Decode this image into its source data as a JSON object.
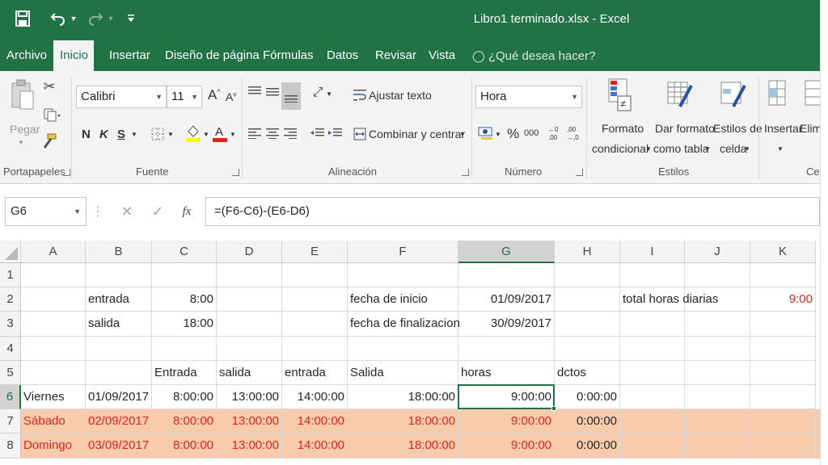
{
  "window": {
    "title": "Libro1 terminado.xlsx - Excel"
  },
  "quick_access": {
    "save_icon": "save-icon",
    "undo_icon": "undo-icon",
    "redo_icon": "redo-icon",
    "customize_icon": "customize-icon"
  },
  "tabs": [
    {
      "label": "Archivo"
    },
    {
      "label": "Inicio"
    },
    {
      "label": "Insertar"
    },
    {
      "label": "Diseño de página"
    },
    {
      "label": "Fórmulas"
    },
    {
      "label": "Datos"
    },
    {
      "label": "Revisar"
    },
    {
      "label": "Vista"
    }
  ],
  "tell_me": "¿Qué desea hacer?",
  "ribbon": {
    "clipboard": {
      "paste_label": "Pegar",
      "group": "Portapapeles"
    },
    "font": {
      "name": "Calibri",
      "size": "11",
      "bold": "N",
      "italic": "K",
      "underline": "S",
      "group": "Fuente"
    },
    "alignment": {
      "wrap": "Ajustar texto",
      "merge": "Combinar y centrar",
      "group": "Alineación"
    },
    "number": {
      "format": "Hora",
      "percent": "%",
      "thousands": "000",
      "group": "Número"
    },
    "styles": {
      "conditional_line1": "Formato",
      "conditional_line2": "condicional",
      "table_line1": "Dar formato",
      "table_line2": "como tabla",
      "cell_line1": "Estilos de",
      "cell_line2": "celda",
      "group": "Estilos"
    },
    "cells": {
      "insert": "Insertar",
      "delete": "Elimi",
      "group": "Cel"
    }
  },
  "formula_bar": {
    "name_box": "G6",
    "formula": "=(F6-C6)-(E6-D6)",
    "fx": "fx"
  },
  "columns": [
    "A",
    "B",
    "C",
    "D",
    "E",
    "F",
    "G",
    "H",
    "I",
    "J",
    "K"
  ],
  "selected": {
    "column": "G",
    "row": "6"
  },
  "rows": [
    {
      "num": "1",
      "cells": {}
    },
    {
      "num": "2",
      "cells": {
        "B": "entrada",
        "C": "8:00",
        "F": "fecha de inicio",
        "G": "01/09/2017",
        "I": "total horas diarias",
        "K": "9:00"
      }
    },
    {
      "num": "3",
      "cells": {
        "B": "salida",
        "C": "18:00",
        "F": "fecha de finalizacion",
        "G": "30/09/2017"
      }
    },
    {
      "num": "4",
      "cells": {}
    },
    {
      "num": "5",
      "cells": {
        "C": "Entrada",
        "D": "salida",
        "E": "entrada",
        "F": "Salida",
        "G": "horas",
        "H": "dctos"
      }
    },
    {
      "num": "6",
      "cells": {
        "A": "Viernes",
        "B": "01/09/2017",
        "C": "8:00:00",
        "D": "13:00:00",
        "E": "14:00:00",
        "F": "18:00:00",
        "G": "9:00:00",
        "H": "0:00:00"
      }
    },
    {
      "num": "7",
      "cells": {
        "A": "Sábado",
        "B": "02/09/2017",
        "C": "8:00:00",
        "D": "13:00:00",
        "E": "14:00:00",
        "F": "18:00:00",
        "G": "9:00:00",
        "H": "0:00:00"
      }
    },
    {
      "num": "8",
      "cells": {
        "A": "Domingo",
        "B": "03/09/2017",
        "C": "8:00:00",
        "D": "13:00:00",
        "E": "14:00:00",
        "F": "18:00:00",
        "G": "9:00:00",
        "H": "0:00:00"
      }
    }
  ],
  "colors": {
    "excel_green": "#217346",
    "weekend_fill": "#f8cbad",
    "red_text": "#e2231a"
  }
}
